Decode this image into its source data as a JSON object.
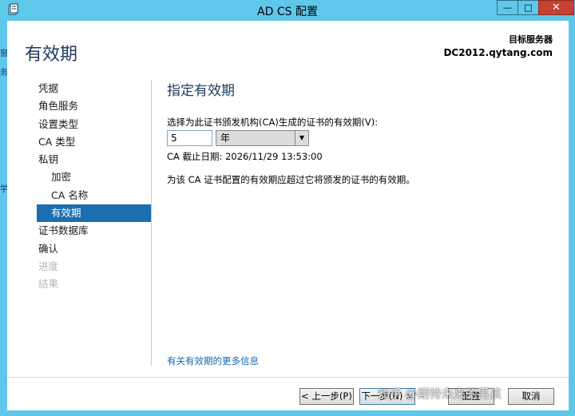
{
  "window": {
    "title": "AD CS 配置",
    "controls": {
      "minimize": "—",
      "maximize": "□",
      "close": "✕"
    }
  },
  "header": {
    "page_title": "有效期",
    "destination_label": "目标服务器",
    "destination_server": "DC2012.qytang.com"
  },
  "sidebar": {
    "items": [
      {
        "label": "凭据",
        "state": "normal",
        "indent": false
      },
      {
        "label": "角色服务",
        "state": "normal",
        "indent": false
      },
      {
        "label": "设置类型",
        "state": "normal",
        "indent": false
      },
      {
        "label": "CA 类型",
        "state": "normal",
        "indent": false
      },
      {
        "label": "私钥",
        "state": "normal",
        "indent": false
      },
      {
        "label": "加密",
        "state": "normal",
        "indent": true
      },
      {
        "label": "CA 名称",
        "state": "normal",
        "indent": true
      },
      {
        "label": "有效期",
        "state": "selected",
        "indent": true
      },
      {
        "label": "证书数据库",
        "state": "normal",
        "indent": false
      },
      {
        "label": "确认",
        "state": "normal",
        "indent": false
      },
      {
        "label": "进度",
        "state": "disabled",
        "indent": false
      },
      {
        "label": "结果",
        "state": "disabled",
        "indent": false
      }
    ]
  },
  "main": {
    "section_title": "指定有效期",
    "field_label": "选择为此证书颁发机构(CA)生成的证书的有效期(V):",
    "validity_value": "5",
    "validity_unit": "年",
    "expiry_text": "CA 截止日期: 2026/11/29 13:53:00",
    "note": "为该 CA 证书配置的有效期应超过它将颁发的证书的有效期。",
    "more_info_link": "有关有效期的更多信息"
  },
  "footer": {
    "prev_label": "< 上一步(P)",
    "next_label": "下一步(N) >",
    "configure_label": "配置",
    "cancel_label": "取消"
  },
  "watermark": "知乎 @期待未来的男孩",
  "background_fragments": [
    "窗",
    "务",
    "学"
  ],
  "colors": {
    "accent": "#5fc7e9",
    "selected": "#1b6fb0",
    "close_button": "#c74034",
    "link": "#1764b0",
    "title": "#1e3a5f"
  }
}
